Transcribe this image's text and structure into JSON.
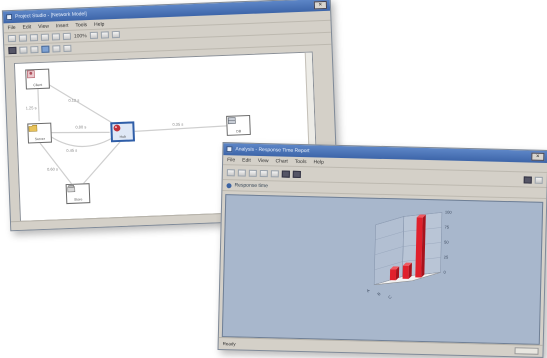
{
  "colors": {
    "titlebar": "#4a72b5",
    "chrome": "#d4d0c8",
    "plot_background": "#a8b7cc",
    "bar": "#e0202c",
    "link": "#d0d0d0"
  },
  "window1": {
    "title": "Project Studio - [Network Model]",
    "close_label": "×",
    "menu": [
      "File",
      "Edit",
      "View",
      "Insert",
      "Tools",
      "Help"
    ],
    "toolbar_label": "100%",
    "nodes": [
      {
        "id": "n1",
        "icon": "user-icon",
        "label": "Client"
      },
      {
        "id": "n2",
        "icon": "folder-icon",
        "label": "Server"
      },
      {
        "id": "n3",
        "icon": "module-icon",
        "label": "Hub"
      },
      {
        "id": "n4",
        "icon": "storage-icon",
        "label": "DB"
      },
      {
        "id": "n5",
        "icon": "archive-icon",
        "label": "Store"
      }
    ],
    "edge_labels": [
      "1.25 s",
      "0.12 s",
      "0.80 s",
      "0.45 s",
      "0.35 s",
      "0.60 s"
    ]
  },
  "window2": {
    "title": "Analysis - Response Time Report",
    "close_label": "×",
    "menu": [
      "File",
      "Edit",
      "View",
      "Chart",
      "Tools",
      "Help"
    ],
    "address": "Response time",
    "status": "Ready"
  },
  "chart_data": {
    "type": "bar",
    "projection": "3d",
    "categories": [
      "A",
      "B",
      "C"
    ],
    "values": [
      18,
      22,
      100
    ],
    "ylim": [
      0,
      100
    ],
    "xlabel": "",
    "ylabel": ""
  }
}
